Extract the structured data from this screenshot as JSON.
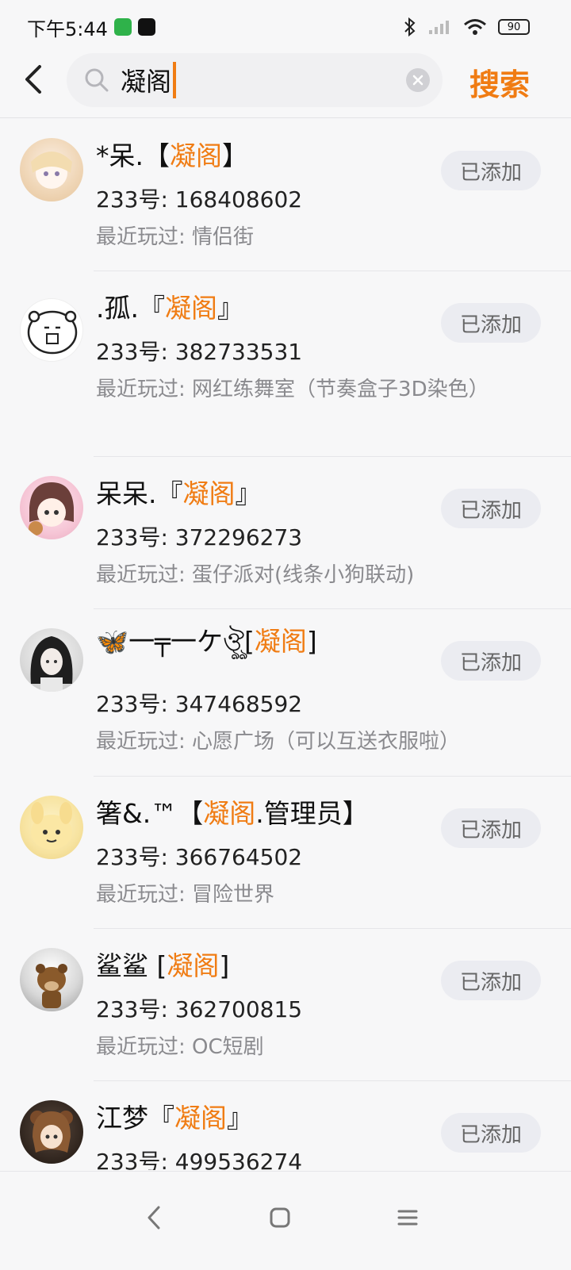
{
  "status": {
    "time": "下午5:44",
    "battery": "90"
  },
  "search": {
    "query": "凝阁",
    "button_label": "搜索"
  },
  "results": [
    {
      "name_prefix": "*呆.【",
      "name_highlight": "凝阁",
      "name_suffix": "】",
      "id": "233号: 168408602",
      "recent": "最近玩过: 情侣街",
      "action": "已添加"
    },
    {
      "name_prefix": ".孤.『",
      "name_highlight": "凝阁",
      "name_suffix": "』",
      "id": "233号: 382733531",
      "recent": "最近玩过: 网红练舞室（节奏盒子3D染色）",
      "action": "已添加"
    },
    {
      "name_prefix": "呆呆.『",
      "name_highlight": "凝阁",
      "name_suffix": "』",
      "id": "233号: 372296273",
      "recent": "最近玩过: 蛋仔派对(线条小狗联动)",
      "action": "已添加"
    },
    {
      "name_prefix": "🦋⼀╤⼀ケঔৣ[",
      "name_highlight": "凝阁",
      "name_suffix": "]",
      "id": "233号: 347468592",
      "recent": "最近玩过: 心愿广场（可以互送衣服啦）",
      "action": "已添加"
    },
    {
      "name_prefix": "箸&.™【",
      "name_highlight": "凝阁",
      "name_suffix": ".管理员】",
      "id": "233号: 366764502",
      "recent": "最近玩过: 冒险世界",
      "action": "已添加"
    },
    {
      "name_prefix": "鲨鲨 [",
      "name_highlight": "凝阁",
      "name_suffix": "]",
      "id": "233号: 362700815",
      "recent": "最近玩过: OC短剧",
      "action": "已添加"
    },
    {
      "name_prefix": "江梦『",
      "name_highlight": "凝阁",
      "name_suffix": "』",
      "id": "233号: 499536274",
      "recent": "",
      "action": "已添加"
    }
  ]
}
